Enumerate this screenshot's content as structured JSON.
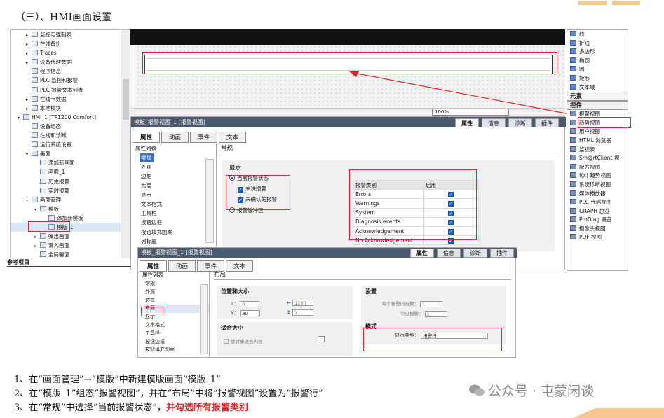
{
  "heading": "（三）、HMI画面设置",
  "tree": {
    "items": [
      {
        "label": "监控与强制表",
        "indent": 0,
        "arrow": "▸"
      },
      {
        "label": "在线备份",
        "indent": 0,
        "arrow": "▸"
      },
      {
        "label": "Traces",
        "indent": 0,
        "arrow": "▸"
      },
      {
        "label": "设备代理数据",
        "indent": 0,
        "arrow": "▸"
      },
      {
        "label": "程序信息",
        "indent": 0,
        "arrow": ""
      },
      {
        "label": "PLC 监控和报警",
        "indent": 0,
        "arrow": ""
      },
      {
        "label": "PLC 报警文本列表",
        "indent": 0,
        "arrow": ""
      },
      {
        "label": "在线卡数据",
        "indent": 0,
        "arrow": "▸"
      },
      {
        "label": "本地模块",
        "indent": 0,
        "arrow": "▸"
      },
      {
        "label": "HMI_1 [TP1200 Comfort]",
        "indent": -1,
        "arrow": "▾"
      },
      {
        "label": "设备组态",
        "indent": 0,
        "arrow": ""
      },
      {
        "label": "在线和诊断",
        "indent": 0,
        "arrow": ""
      },
      {
        "label": "运行系统设置",
        "indent": 0,
        "arrow": ""
      },
      {
        "label": "画面",
        "indent": 0,
        "arrow": "▾"
      },
      {
        "label": "添加新画面",
        "indent": 1,
        "arrow": ""
      },
      {
        "label": "画面_1",
        "indent": 1,
        "arrow": ""
      },
      {
        "label": "历史报警",
        "indent": 1,
        "arrow": ""
      },
      {
        "label": "实时报警",
        "indent": 1,
        "arrow": ""
      },
      {
        "label": "画面管理",
        "indent": 0,
        "arrow": "▾"
      },
      {
        "label": "模板",
        "indent": 1,
        "arrow": "▾"
      },
      {
        "label": "添加新模板",
        "indent": 2,
        "arrow": ""
      },
      {
        "label": "模版_1",
        "indent": 2,
        "arrow": ""
      },
      {
        "label": "弹出画面",
        "indent": 1,
        "arrow": "▸"
      },
      {
        "label": "滑入画面",
        "indent": 1,
        "arrow": "▸"
      },
      {
        "label": "全局画面",
        "indent": 1,
        "arrow": ""
      }
    ],
    "footer": "参考项目"
  },
  "zoom": "100%",
  "panel1": {
    "title": "模板_报警视图_1 [报警视图]",
    "tabs": [
      "属性",
      "信息",
      "诊断",
      "插件"
    ],
    "subtabs": [
      "属性",
      "动画",
      "事件",
      "文本"
    ],
    "list_title": "属性列表",
    "list": [
      "常规",
      "外观",
      "边框",
      "布局",
      "显示",
      "文本格式",
      "工具栏",
      "按钮边框",
      "按钮填充图案",
      "列标题"
    ],
    "section": "常规",
    "group": "显示",
    "radio1": "当前报警状态",
    "check1": "未决报警",
    "check2": "未确认的报警",
    "radio2": "报警缓冲区",
    "table_headers": [
      "报警类别",
      "启用"
    ],
    "table_rows": [
      "Errors",
      "Warnings",
      "System",
      "Diagnosis events",
      "Acknowledgement",
      "No Acknowledgement"
    ]
  },
  "panel2": {
    "title": "模板_报警视图_1 [报警视图]",
    "tabs": [
      "属性",
      "信息",
      "诊断",
      "插件"
    ],
    "subtabs": [
      "属性",
      "动画",
      "事件",
      "文本"
    ],
    "list_title": "属性列表",
    "list": [
      "常规",
      "外观",
      "边框",
      "布局",
      "显示",
      "文本格式",
      "工具栏",
      "按钮边框",
      "按钮填充图案"
    ],
    "section": "布局",
    "pos_title": "位置和大小",
    "x_label": "X：",
    "x_val": "0",
    "y_label": "Y：",
    "y_val": "30",
    "w_val": "1280",
    "h_val": "21",
    "fit_title": "适合大小",
    "fit_check": "使对象适合内容",
    "set_title": "设置",
    "rows_label": "每个报警的行数：",
    "rows_val": "1",
    "visible_label": "可见报警：",
    "visible_val": "1",
    "mode_title": "模式",
    "display_label": "显示类型：",
    "display_val": "报警行"
  },
  "tools": {
    "basic": [
      "线",
      "折线",
      "多边形",
      "椭圆",
      "圆",
      "矩形",
      "文本域"
    ],
    "elements_head": "元素",
    "controls_head": "控件",
    "controls": [
      "报警视图",
      "趋势视图",
      "用户视图",
      "HTML 浏览器",
      "监视表",
      "Sm@rtClient 视",
      "配方视图",
      "f(x) 趋势视图",
      "系统诊断视图",
      "媒体播放器",
      "PLC 代码视图",
      "GRAPH 总览",
      "ProDiag 概览",
      "摄像头视图",
      "PDF 视图"
    ]
  },
  "notes": {
    "n1": "1、在“画面管理”→“模版”中新建模版画面“模版_1”",
    "n2": "2、在“模版_1”组态“报警视图”，并在“布局”中将“报警视图”设置为“报警行”",
    "n3a": "3、在“常规”中选择“当前报警状态”，",
    "n3b": "并勾选所有报警类别"
  },
  "watermark": "公众号 · 屯蒙闲谈"
}
